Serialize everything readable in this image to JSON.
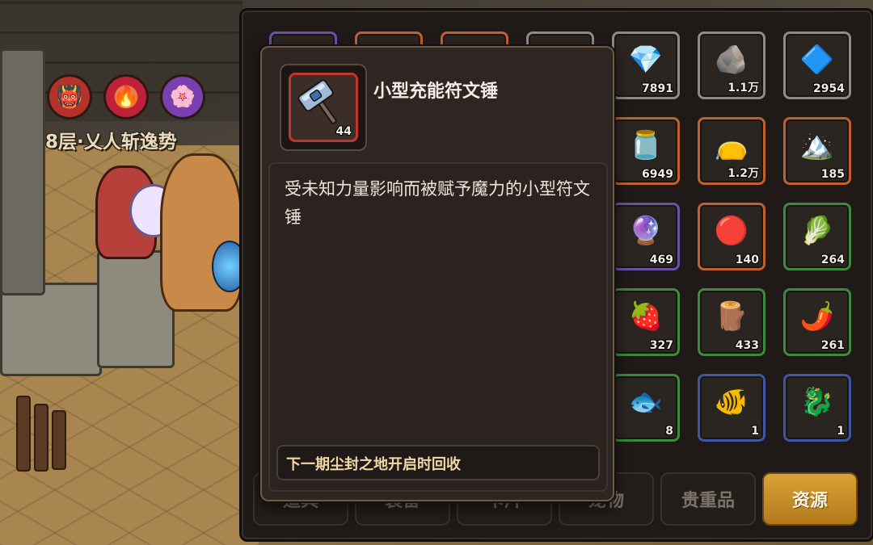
{
  "scene": {
    "floor_label": "8层·乂人斩逸势",
    "boss_icons": [
      "demon-mask-icon",
      "fire-spirit-icon",
      "purple-flower-icon"
    ]
  },
  "tooltip": {
    "item_name": "小型充能符文锤",
    "item_quantity": "44",
    "item_icon": "rune-hammer-icon",
    "description": "受未知力量影响而被赋予魔力的小型符文锤",
    "recycle_note": "下一期尘封之地开启时回收",
    "rarity_color": "#c4342a"
  },
  "inventory": {
    "rows": [
      [
        {
          "icon": "",
          "count": "",
          "rarity": "purple"
        },
        {
          "icon": "",
          "count": "",
          "rarity": "orange"
        },
        {
          "icon": "",
          "count": "",
          "rarity": "orange"
        },
        {
          "icon": "",
          "count": "",
          "rarity": "grey"
        },
        {
          "icon": "💎",
          "count": "7891",
          "rarity": "grey"
        },
        {
          "icon": "🪨",
          "count": "1.1万",
          "rarity": "grey"
        },
        {
          "icon": "🔷",
          "count": "2954",
          "rarity": "grey"
        }
      ],
      [
        {
          "icon": "",
          "count": "",
          "rarity": "dim"
        },
        {
          "icon": "",
          "count": "",
          "rarity": "dim"
        },
        {
          "icon": "",
          "count": "",
          "rarity": "dim"
        },
        {
          "icon": "",
          "count": "",
          "rarity": "dim"
        },
        {
          "icon": "🫙",
          "count": "6949",
          "rarity": "orange"
        },
        {
          "icon": "👝",
          "count": "1.2万",
          "rarity": "orange"
        },
        {
          "icon": "🏔️",
          "count": "185",
          "rarity": "orange"
        }
      ],
      [
        {
          "icon": "",
          "count": "",
          "rarity": "dim"
        },
        {
          "icon": "",
          "count": "",
          "rarity": "dim"
        },
        {
          "icon": "",
          "count": "",
          "rarity": "dim"
        },
        {
          "icon": "",
          "count": "",
          "rarity": "dim"
        },
        {
          "icon": "🔮",
          "count": "469",
          "rarity": "purple"
        },
        {
          "icon": "🔴",
          "count": "140",
          "rarity": "orange"
        },
        {
          "icon": "🥬",
          "count": "264",
          "rarity": "green"
        }
      ],
      [
        {
          "icon": "",
          "count": "",
          "rarity": "dim"
        },
        {
          "icon": "",
          "count": "",
          "rarity": "dim"
        },
        {
          "icon": "",
          "count": "",
          "rarity": "dim"
        },
        {
          "icon": "",
          "count": "",
          "rarity": "dim"
        },
        {
          "icon": "🍓",
          "count": "327",
          "rarity": "green"
        },
        {
          "icon": "🪵",
          "count": "433",
          "rarity": "green"
        },
        {
          "icon": "🌶️",
          "count": "261",
          "rarity": "green"
        }
      ],
      [
        {
          "icon": "",
          "count": "",
          "rarity": "dim"
        },
        {
          "icon": "",
          "count": "",
          "rarity": "dim"
        },
        {
          "icon": "",
          "count": "",
          "rarity": "dim"
        },
        {
          "icon": "",
          "count": "",
          "rarity": "dim"
        },
        {
          "icon": "🐟",
          "count": "8",
          "rarity": "green"
        },
        {
          "icon": "🐠",
          "count": "1",
          "rarity": "blue"
        },
        {
          "icon": "🐉",
          "count": "1",
          "rarity": "blue"
        }
      ]
    ],
    "tabs": [
      {
        "label": "道具",
        "active": false
      },
      {
        "label": "装备",
        "active": false
      },
      {
        "label": "卡片",
        "active": false
      },
      {
        "label": "宠物",
        "active": false
      },
      {
        "label": "贵重品",
        "active": false
      },
      {
        "label": "资源",
        "active": true
      }
    ]
  }
}
